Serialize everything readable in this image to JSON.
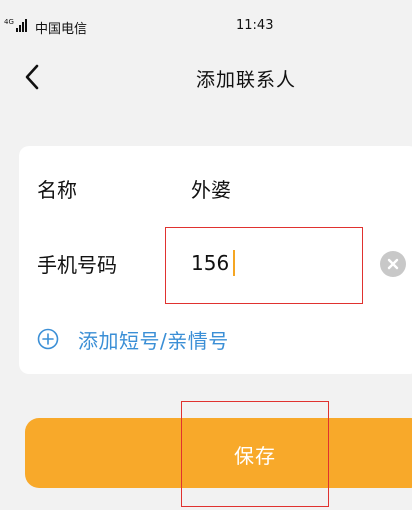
{
  "status_bar": {
    "network": "4G",
    "carrier": "中国电信",
    "time": "11:43"
  },
  "header": {
    "back_icon": "chevron-left-icon",
    "title": "添加联系人"
  },
  "form": {
    "name_label": "名称",
    "name_value": "外婆",
    "phone_label": "手机号码",
    "phone_value": "156",
    "clear_icon": "clear-circle-icon",
    "add_icon": "plus-circle-icon",
    "add_label": "添加短号/亲情号"
  },
  "actions": {
    "save_label": "保存"
  },
  "colors": {
    "accent": "#f8a92a",
    "link": "#3b8fd6",
    "highlight": "#e0322f",
    "background": "#f2f2f2"
  }
}
